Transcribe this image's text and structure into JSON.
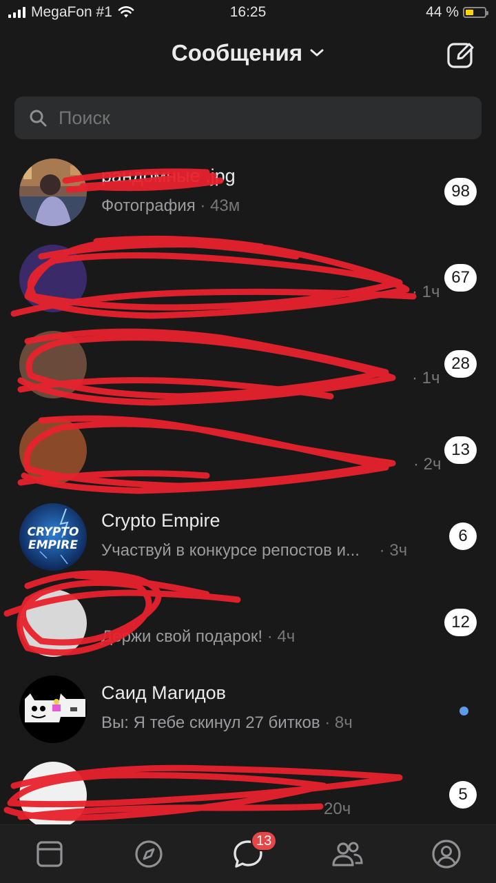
{
  "status_bar": {
    "carrier": "MegaFon #1",
    "time": "16:25",
    "battery_percent": "44 %",
    "battery_level": 0.44
  },
  "header": {
    "title": "Сообщения"
  },
  "search": {
    "placeholder": "Поиск"
  },
  "chats": [
    {
      "name": "рандомные .jpg",
      "preview": "Фотография",
      "time": "· 43м",
      "badge": "98"
    },
    {
      "name": "",
      "preview": "",
      "time": "· 1ч",
      "badge": "67"
    },
    {
      "name": "",
      "preview": "",
      "time": "· 1ч",
      "badge": "28"
    },
    {
      "name": "",
      "preview": "",
      "time": "· 2ч",
      "badge": "13"
    },
    {
      "name": "Crypto Empire",
      "preview": "Участвуй в конкурсе репостов и...",
      "time": "· 3ч",
      "badge": "6",
      "avatar_text_1": "CRYPTO",
      "avatar_text_2": "EMPIRE"
    },
    {
      "name": "",
      "preview": "Держи свой подарок!",
      "time": "· 4ч",
      "badge": "12"
    },
    {
      "name": "Саид Магидов",
      "preview": "Вы: Я тебе скинул 27 битков",
      "time": "· 8ч",
      "unread": true
    },
    {
      "name": "",
      "preview": "",
      "time": "20ч",
      "badge": "5"
    }
  ],
  "tabbar": {
    "tabs": [
      "feed-icon",
      "discover-icon",
      "messages-icon",
      "friends-icon",
      "profile-icon"
    ],
    "messages_badge": "13",
    "active_tab": "messages-icon"
  },
  "colors": {
    "background": "#19191a",
    "search_bg": "#2c2d2e",
    "badge_bg": "#ffffff",
    "tab_badge_bg": "#e64646",
    "accent_dot": "#5c9ce6",
    "scribble": "#e8222d"
  }
}
